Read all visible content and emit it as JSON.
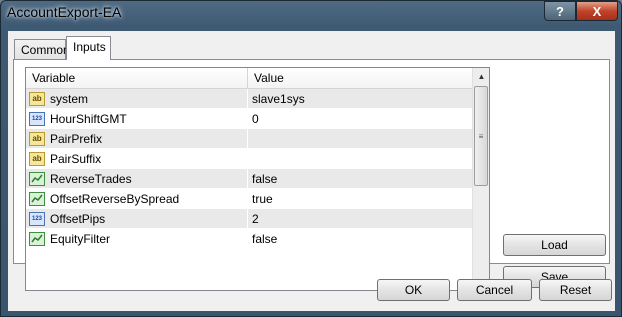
{
  "window": {
    "title": "AccountExport-EA",
    "help_label": "?",
    "close_label": "X"
  },
  "tabs": [
    {
      "label": "Common",
      "active": false
    },
    {
      "label": "Inputs",
      "active": true
    }
  ],
  "grid": {
    "columns": [
      "Variable",
      "Value"
    ],
    "rows": [
      {
        "icon": "string-type-icon",
        "variable": "system",
        "value": "slave1sys"
      },
      {
        "icon": "integer-type-icon",
        "variable": "HourShiftGMT",
        "value": "0"
      },
      {
        "icon": "string-type-icon",
        "variable": "PairPrefix",
        "value": ""
      },
      {
        "icon": "string-type-icon",
        "variable": "PairSuffix",
        "value": ""
      },
      {
        "icon": "boolean-type-icon",
        "variable": "ReverseTrades",
        "value": "false"
      },
      {
        "icon": "boolean-type-icon",
        "variable": "OffsetReverseBySpread",
        "value": "true"
      },
      {
        "icon": "integer-type-icon",
        "variable": "OffsetPips",
        "value": "2"
      },
      {
        "icon": "boolean-type-icon",
        "variable": "EquityFilter",
        "value": "false"
      }
    ]
  },
  "buttons": {
    "load": "Load",
    "save": "Save",
    "ok": "OK",
    "cancel": "Cancel",
    "reset": "Reset"
  }
}
